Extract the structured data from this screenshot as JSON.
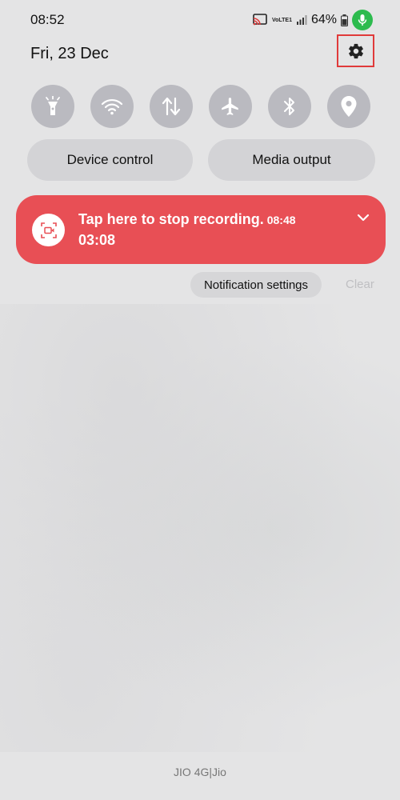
{
  "status_bar": {
    "time": "08:52",
    "battery_percent": "64%",
    "volte_label": "VoLTE1",
    "icons": [
      "screen-cast-icon",
      "volte-icon",
      "signal-icon",
      "battery-icon",
      "mic-icon"
    ]
  },
  "header": {
    "date": "Fri, 23 Dec",
    "settings_icon": "gear-icon"
  },
  "quick_toggles": [
    {
      "name": "flashlight",
      "icon": "flashlight-icon"
    },
    {
      "name": "wifi",
      "icon": "wifi-icon"
    },
    {
      "name": "mobile-data",
      "icon": "data-arrows-icon"
    },
    {
      "name": "airplane-mode",
      "icon": "airplane-icon"
    },
    {
      "name": "bluetooth",
      "icon": "bluetooth-icon"
    },
    {
      "name": "location",
      "icon": "location-pin-icon"
    }
  ],
  "buttons": {
    "device_control": "Device control",
    "media_output": "Media output"
  },
  "notification": {
    "title": "Tap here to stop recording.",
    "time": "08:48",
    "subtitle": "03:08",
    "color": "#e84f55",
    "icon": "screen-record-icon"
  },
  "notification_actions": {
    "settings": "Notification settings",
    "clear": "Clear"
  },
  "footer": {
    "carrier": "JIO 4G|Jio"
  }
}
